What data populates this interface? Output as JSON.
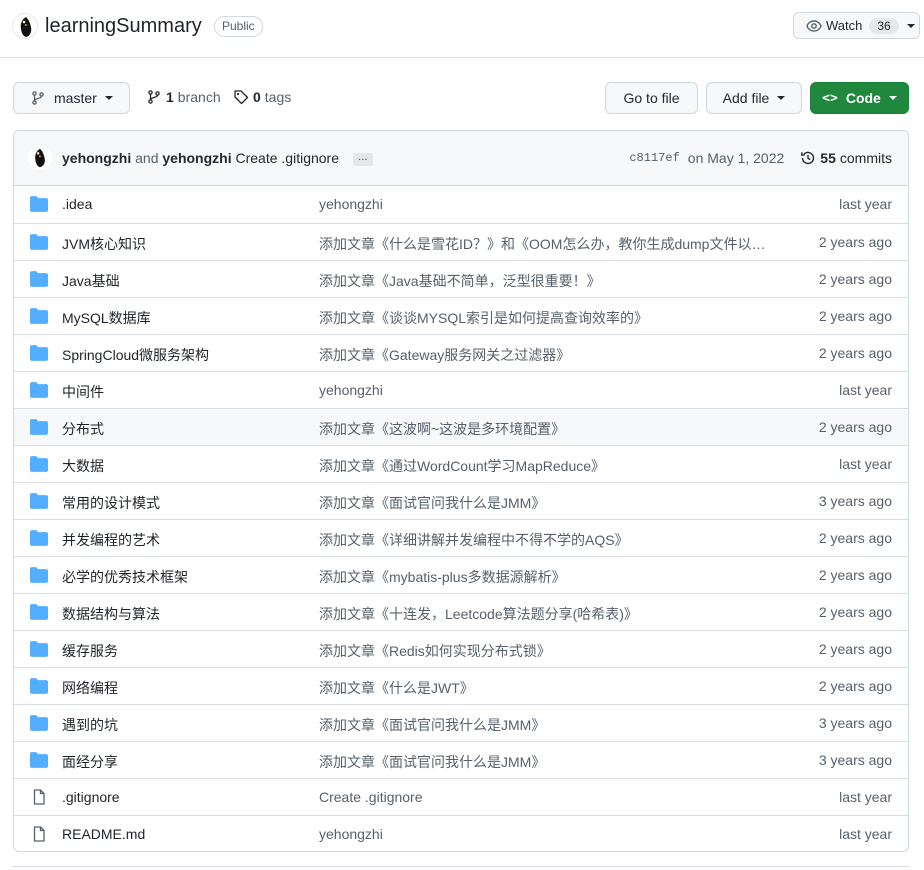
{
  "repo": {
    "name": "learningSummary",
    "visibility": "Public",
    "watch_label": "Watch",
    "watch_count": "36"
  },
  "toolbar": {
    "branch_name": "master",
    "branch_count": "1",
    "branch_label": "branch",
    "tag_count": "0",
    "tag_label": "tags",
    "go_to_file": "Go to file",
    "add_file": "Add file",
    "code": "Code"
  },
  "commit": {
    "author": "yehongzhi",
    "and_text": "and",
    "coauthor": "yehongzhi",
    "message": "Create .gitignore",
    "ellipsis": "…",
    "sha": "c8117ef",
    "date": "on May 1, 2022",
    "commit_count": "55",
    "commits_label": "commits"
  },
  "files": [
    {
      "type": "folder",
      "name": ".idea",
      "message": "yehongzhi",
      "age": "last year"
    },
    {
      "type": "folder",
      "name": "JVM核心知识",
      "message": "添加文章《什么是雪花ID？》和《OOM怎么办，教你生成dump文件以…",
      "age": "2 years ago"
    },
    {
      "type": "folder",
      "name": "Java基础",
      "message": "添加文章《Java基础不简单，泛型很重要！》",
      "age": "2 years ago"
    },
    {
      "type": "folder",
      "name": "MySQL数据库",
      "message": "添加文章《谈谈MYSQL索引是如何提高查询效率的》",
      "age": "2 years ago"
    },
    {
      "type": "folder",
      "name": "SpringCloud微服务架构",
      "message": "添加文章《Gateway服务网关之过滤器》",
      "age": "2 years ago"
    },
    {
      "type": "folder",
      "name": "中间件",
      "message": "yehongzhi",
      "age": "last year"
    },
    {
      "type": "folder",
      "name": "分布式",
      "message": "添加文章《这波啊~这波是多环境配置》",
      "age": "2 years ago"
    },
    {
      "type": "folder",
      "name": "大数据",
      "message": "添加文章《通过WordCount学习MapReduce》",
      "age": "last year"
    },
    {
      "type": "folder",
      "name": "常用的设计模式",
      "message": "添加文章《面试官问我什么是JMM》",
      "age": "3 years ago"
    },
    {
      "type": "folder",
      "name": "并发编程的艺术",
      "message": "添加文章《详细讲解并发编程中不得不学的AQS》",
      "age": "2 years ago"
    },
    {
      "type": "folder",
      "name": "必学的优秀技术框架",
      "message": "添加文章《mybatis-plus多数据源解析》",
      "age": "2 years ago"
    },
    {
      "type": "folder",
      "name": "数据结构与算法",
      "message": "添加文章《十连发，Leetcode算法题分享(哈希表)》",
      "age": "2 years ago"
    },
    {
      "type": "folder",
      "name": "缓存服务",
      "message": "添加文章《Redis如何实现分布式锁》",
      "age": "2 years ago"
    },
    {
      "type": "folder",
      "name": "网络编程",
      "message": "添加文章《什么是JWT》",
      "age": "2 years ago"
    },
    {
      "type": "folder",
      "name": "遇到的坑",
      "message": "添加文章《面试官问我什么是JMM》",
      "age": "3 years ago"
    },
    {
      "type": "folder",
      "name": "面经分享",
      "message": "添加文章《面试官问我什么是JMM》",
      "age": "3 years ago"
    },
    {
      "type": "file",
      "name": ".gitignore",
      "message": "Create .gitignore",
      "age": "last year"
    },
    {
      "type": "file",
      "name": "README.md",
      "message": "yehongzhi",
      "age": "last year"
    }
  ],
  "colors": {
    "folder": "#54aeff",
    "file_icon": "#57606a",
    "code_button": "#1f883d",
    "row_highlight": "#f6f8fa"
  },
  "highlighted_row": 6
}
